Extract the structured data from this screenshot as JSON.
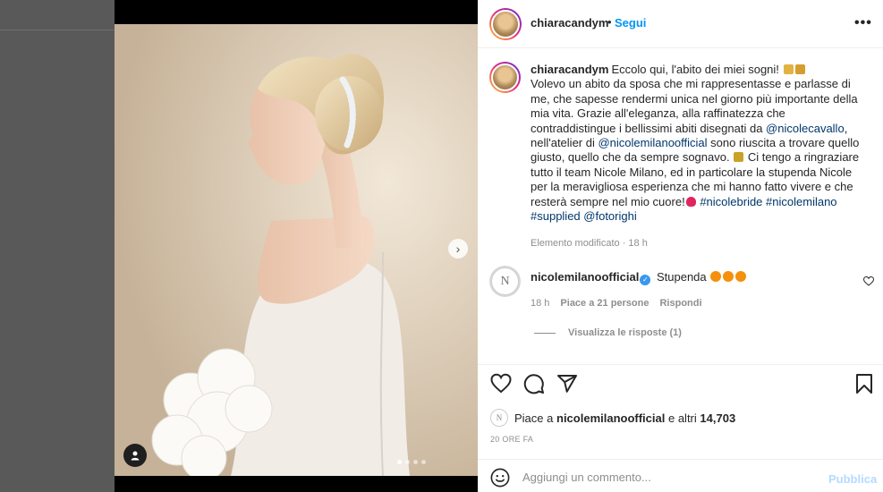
{
  "post": {
    "username": "chiaracandym",
    "follow_label": "Segui",
    "separator": "•",
    "more_label": "•••",
    "caption": {
      "lines": [
        {
          "segments": [
            {
              "t": "Eccolo qui, l'abito dei miei sogni! "
            },
            {
              "emoji": "emoji-bride"
            },
            {
              "emoji": "emoji-ring"
            }
          ]
        },
        {
          "segments": [
            {
              "t": "Volevo un abito da sposa che mi rappresentasse e parlasse di"
            }
          ]
        },
        {
          "segments": [
            {
              "t": "me, che sapesse rendermi unica nel giorno più importante della"
            }
          ]
        },
        {
          "segments": [
            {
              "t": "mia vita. Grazie all'eleganza, alla raffinatezza che"
            }
          ]
        },
        {
          "segments": [
            {
              "t": "contraddistingue i bellissimi abiti disegnati da "
            },
            {
              "link": "@nicolecavallo"
            },
            {
              "t": ","
            }
          ]
        },
        {
          "segments": [
            {
              "t": "nell'atelier di "
            },
            {
              "link": "@nicolemilanoofficial"
            },
            {
              "t": " sono riuscita a trovare quello"
            }
          ]
        },
        {
          "segments": [
            {
              "t": "giusto, quello che da sempre sognavo. "
            },
            {
              "emoji": "emoji-sparkles"
            },
            {
              "t": " Ci tengo a ringraziare"
            }
          ]
        },
        {
          "segments": [
            {
              "t": "tutto il team Nicole Milano, ed in particolare la stupenda Nicole"
            }
          ]
        },
        {
          "segments": [
            {
              "t": "per la meravigliosa esperienza che mi hanno fatto vivere e che"
            }
          ]
        },
        {
          "segments": [
            {
              "t": "resterà sempre nel mio cuore!"
            },
            {
              "emoji": "emoji-heart"
            },
            {
              "t": " "
            },
            {
              "link": "#nicolebride"
            },
            {
              "t": " "
            },
            {
              "link": "#nicolemilano"
            }
          ]
        },
        {
          "segments": [
            {
              "link": "#supplied"
            },
            {
              "t": " "
            },
            {
              "link": "@fotorighi"
            }
          ]
        }
      ],
      "edited_meta": "Elemento modificato · 18 h"
    },
    "comment": {
      "username": "nicolemilanoofficial",
      "verified_mark": "✓",
      "text": "Stupenda",
      "avatar_letter": "N",
      "time": "18 h",
      "likes": "Piace a 21 persone",
      "reply": "Rispondi",
      "view_replies": "Visualizza le risposte (1)"
    },
    "likes": {
      "prefix": "Piace a",
      "user": "nicolemilanoofficial",
      "conj": "e altri",
      "count": "14,703",
      "avatar_letter": "N"
    },
    "time_ago": "20 ORE FA",
    "comment_input": {
      "placeholder": "Aggiungi un commento...",
      "value": ""
    },
    "publish_label": "Pubblica",
    "carousel": {
      "slides": 4,
      "active_index": 0,
      "next_glyph": "›"
    }
  },
  "colors": {
    "link": "#00376b",
    "follow": "#0095f6",
    "publish_disabled": "#b3dbff",
    "muted": "#8e8e8e",
    "backdrop": "#565656"
  },
  "emojis": {
    "emoji-bride": "#e3b341",
    "emoji-ring": "#d69e2e",
    "emoji-sparkles": "#c9a227",
    "emoji-heart": "#e0245e",
    "emoji-heart-eyes": "#f4900c"
  }
}
